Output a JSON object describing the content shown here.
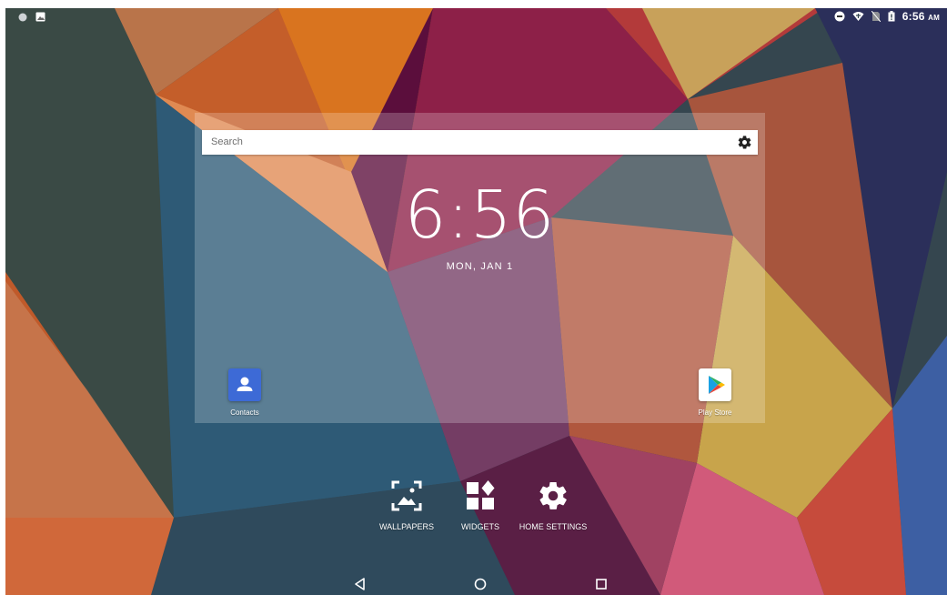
{
  "status_bar": {
    "time": "6:56",
    "ampm": "AM",
    "left_icons": [
      "notification-dot-icon",
      "image-notification-icon"
    ],
    "right_icons": [
      "do-not-disturb-icon",
      "wifi-icon",
      "no-sim-icon",
      "battery-icon"
    ]
  },
  "search": {
    "placeholder": "Search",
    "settings_icon": "gear-icon"
  },
  "clock": {
    "time": "6:56",
    "date": "MON, JAN 1"
  },
  "apps": [
    {
      "label": "Contacts",
      "icon": "contacts-icon",
      "color": "#3d6ad6"
    },
    {
      "label": "Play Store",
      "icon": "play-store-icon",
      "color": "#ffffff"
    }
  ],
  "overview_options": [
    {
      "label": "WALLPAPERS",
      "icon": "wallpapers-icon"
    },
    {
      "label": "WIDGETS",
      "icon": "widgets-icon"
    },
    {
      "label": "HOME SETTINGS",
      "icon": "home-settings-gear-icon"
    }
  ],
  "nav_bar": {
    "buttons": [
      "back-icon",
      "home-icon",
      "recents-icon"
    ]
  }
}
